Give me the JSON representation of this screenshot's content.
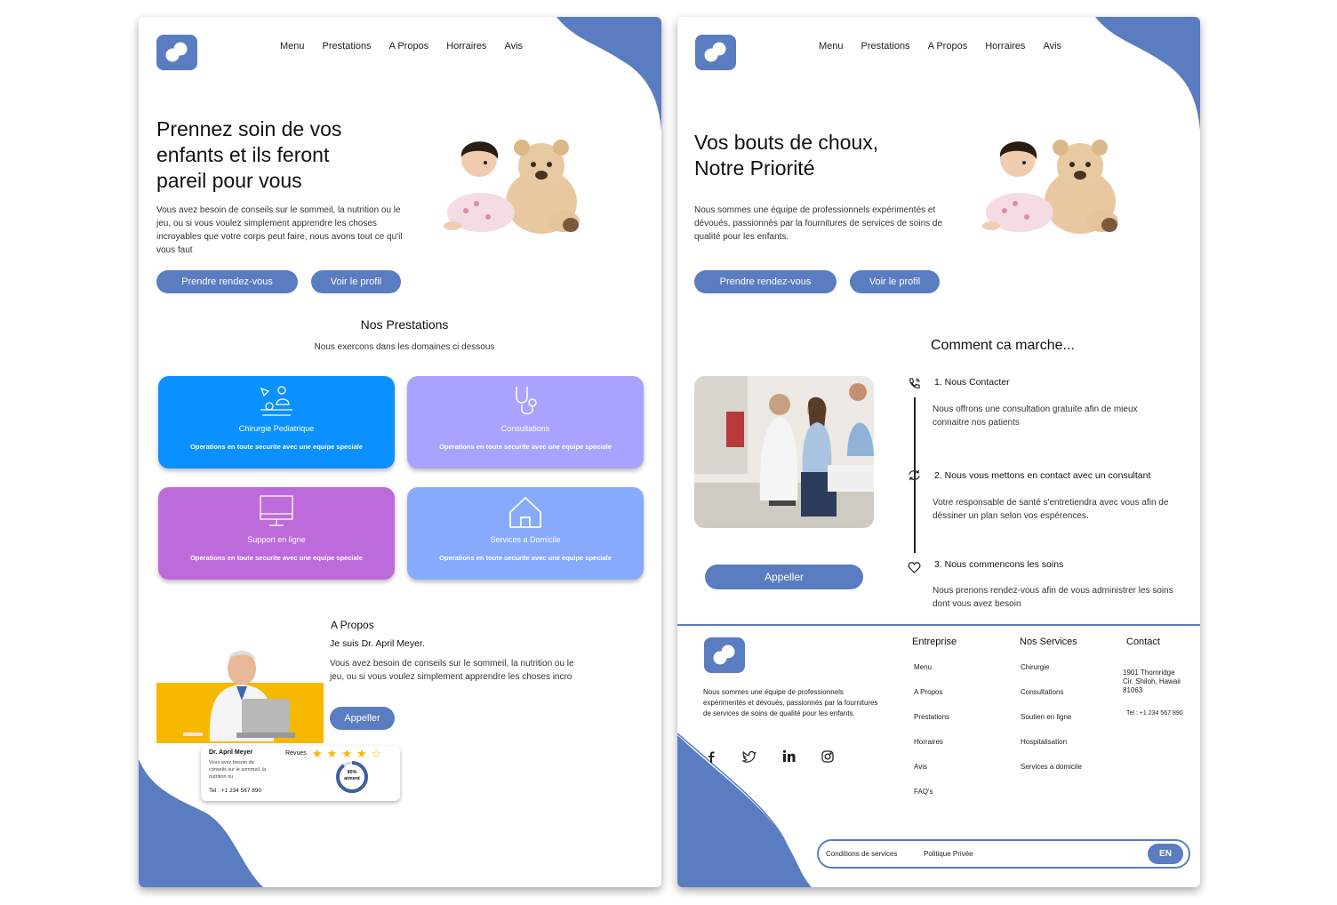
{
  "brand": {
    "accent": "#5a7cc0"
  },
  "nav": {
    "items": [
      "Menu",
      "Prestations",
      "A Propos",
      "Horraires",
      "Avis"
    ]
  },
  "page1": {
    "hero": {
      "title": "Prennez soin de vos enfants et ils feront pareil pour vous",
      "text": "Vous avez besoin de conseils sur le sommeil, la nutrition ou le jeu, ou si vous voulez simplement apprendre les choses incroyables que votre corps peut faire, nous avons tout ce qu'il vous faut",
      "primary_button": "Prendre rendez-vous",
      "secondary_button": "Voir le profil"
    },
    "prestations": {
      "title": "Nos Prestations",
      "subtitle": "Nous exercons dans les domaines ci dessous",
      "cards": [
        {
          "title": "Chirurgie Pediatrique",
          "desc": "Operations en toute securite avec une equipe speciale",
          "color": "#0a90ff",
          "icon": "surgery-icon"
        },
        {
          "title": "Consultations",
          "desc": "Operations en toute securite avec une equipe speciale",
          "color": "#a9a3ff",
          "icon": "stethoscope-icon"
        },
        {
          "title": "Support en ligne",
          "desc": "Operations en toute securite avec une equipe speciale",
          "color": "#bd6bdb",
          "icon": "monitor-icon"
        },
        {
          "title": "Services a Domicile",
          "desc": "Operations en toute securite avec une equipe speciale",
          "color": "#87aafd",
          "icon": "home-icon"
        }
      ]
    },
    "apropos": {
      "label": "A Propos",
      "name": "Je suis Dr. April Meyer.",
      "text": "Vous avez besoin de conseils sur le sommeil, la nutrition ou le jeu, ou si vous voulez simplement apprendre les choses incro",
      "button": "Appeller",
      "card": {
        "name": "Dr. April Meyer",
        "text": "Vous avez besoin de conseils sur le sommeil, la nutrition ou",
        "phone": "Tel : +1 234 567 890",
        "reviews_label": "Revues",
        "rating": 4,
        "rating_max": 5,
        "percent": "90%",
        "percent_label": "aiment",
        "percent_value": 90
      }
    }
  },
  "page2": {
    "hero": {
      "title_line1": "Vos bouts de choux,",
      "title_line2": "Notre Priorité",
      "text": "Nous sommes une équipe de professionnels expérimentés et dévoués, passionnés par la fournitures de services de soins de qualité pour les enfants.",
      "primary_button": "Prendre rendez-vous",
      "secondary_button": "Voir le profil"
    },
    "how": {
      "title": "Comment ca marche...",
      "steps": [
        {
          "title": "1. Nous Contacter",
          "text": "Nous offrons une consultation gratuite afin de mieux connaitre nos patients",
          "icon": "phone-icon"
        },
        {
          "title": "2. Nous vous mettons en contact avec un consultant",
          "text": "Votre responsable de santé  s'entretiendra avec vous afin de déssiner un plan selon vos espérences.",
          "icon": "sync-icon"
        },
        {
          "title": "3. Nous commencons les soins",
          "text": "Nous prenons rendez-vous afin de vous administrer les soins dont vous avez besoin",
          "icon": "heart-icon"
        }
      ],
      "button": "Appeller"
    },
    "footer": {
      "about": "Nous sommes une équipe de professionnels expérimentés et dévoués, passionnés par la fournitures de services de soins de qualité pour les enfants.",
      "entreprise": {
        "title": "Entreprise",
        "links": [
          "Menu",
          "A Propos",
          "Prestations",
          "Horraires",
          "Avis",
          "FAQ's"
        ]
      },
      "services": {
        "title": "Nos Services",
        "links": [
          "Chirurgie",
          "Consultations",
          "Soutien en ligne",
          "Hospitalisation",
          "Services a domicile"
        ]
      },
      "contact": {
        "title": "Contact",
        "address": "1901 Thornridge Cir. Shiloh, Hawaii 81063",
        "phone": "Tel : +1 234 567 890"
      },
      "social": [
        "facebook-icon",
        "twitter-icon",
        "linkedin-icon",
        "instagram-icon"
      ],
      "bottom": {
        "terms": "Conditions de services",
        "privacy": "Politique Privée",
        "lang": "EN"
      }
    }
  }
}
